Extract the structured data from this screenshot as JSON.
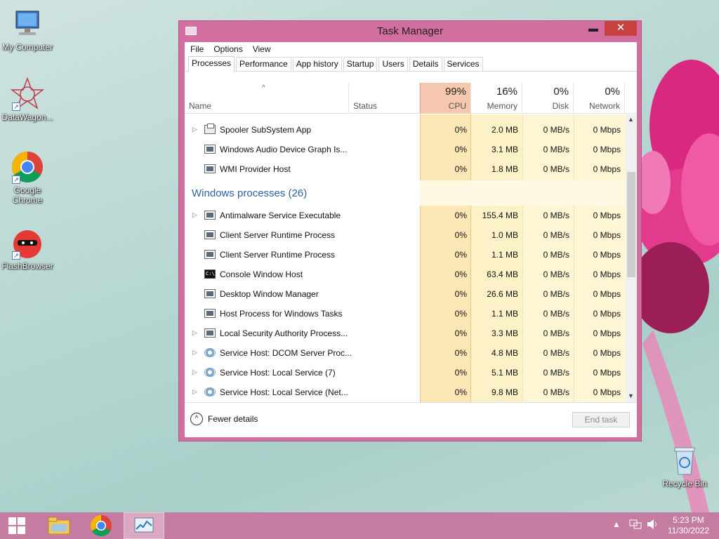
{
  "desktop": {
    "icons": [
      {
        "label": "My Computer"
      },
      {
        "label": "DataWagon..."
      },
      {
        "label": "Google Chrome"
      },
      {
        "label": "FlashBrowser"
      },
      {
        "label": "Recycle Bin"
      }
    ]
  },
  "window": {
    "title": "Task Manager",
    "close_glyph": "✕",
    "min_glyph": "▬",
    "max_glyph": "☐"
  },
  "menu": [
    "File",
    "Options",
    "View"
  ],
  "tabs": [
    "Processes",
    "Performance",
    "App history",
    "Startup",
    "Users",
    "Details",
    "Services"
  ],
  "header": {
    "name": "Name",
    "status": "Status",
    "cpu_pct": "99%",
    "cpu": "CPU",
    "mem_pct": "16%",
    "mem": "Memory",
    "disk_pct": "0%",
    "disk": "Disk",
    "net_pct": "0%",
    "net": "Network"
  },
  "group": "Windows processes (26)",
  "rows": [
    {
      "name": "Spooler SubSystem App",
      "cpu": "0%",
      "mem": "2.0 MB",
      "disk": "0 MB/s",
      "net": "0 Mbps",
      "icon": "printer-icon",
      "expand": true
    },
    {
      "name": "Windows Audio Device Graph Is...",
      "cpu": "0%",
      "mem": "3.1 MB",
      "disk": "0 MB/s",
      "net": "0 Mbps",
      "icon": "window-icon",
      "expand": false
    },
    {
      "name": "WMI Provider Host",
      "cpu": "0%",
      "mem": "1.8 MB",
      "disk": "0 MB/s",
      "net": "0 Mbps",
      "icon": "wmi-icon",
      "expand": false
    },
    {
      "name": "Antimalware Service Executable",
      "cpu": "0%",
      "mem": "155.4 MB",
      "disk": "0 MB/s",
      "net": "0 Mbps",
      "icon": "window-icon",
      "expand": true
    },
    {
      "name": "Client Server Runtime Process",
      "cpu": "0%",
      "mem": "1.0 MB",
      "disk": "0 MB/s",
      "net": "0 Mbps",
      "icon": "window-icon",
      "expand": false
    },
    {
      "name": "Client Server Runtime Process",
      "cpu": "0%",
      "mem": "1.1 MB",
      "disk": "0 MB/s",
      "net": "0 Mbps",
      "icon": "window-icon",
      "expand": false
    },
    {
      "name": "Console Window Host",
      "cpu": "0%",
      "mem": "63.4 MB",
      "disk": "0 MB/s",
      "net": "0 Mbps",
      "icon": "console-icon",
      "expand": false
    },
    {
      "name": "Desktop Window Manager",
      "cpu": "0%",
      "mem": "26.6 MB",
      "disk": "0 MB/s",
      "net": "0 Mbps",
      "icon": "window-icon",
      "expand": false
    },
    {
      "name": "Host Process for Windows Tasks",
      "cpu": "0%",
      "mem": "1.1 MB",
      "disk": "0 MB/s",
      "net": "0 Mbps",
      "icon": "window-icon",
      "expand": false
    },
    {
      "name": "Local Security Authority Process...",
      "cpu": "0%",
      "mem": "3.3 MB",
      "disk": "0 MB/s",
      "net": "0 Mbps",
      "icon": "window-icon",
      "expand": true
    },
    {
      "name": "Service Host: DCOM Server Proc...",
      "cpu": "0%",
      "mem": "4.8 MB",
      "disk": "0 MB/s",
      "net": "0 Mbps",
      "icon": "gear-icon",
      "expand": true
    },
    {
      "name": "Service Host: Local Service (7)",
      "cpu": "0%",
      "mem": "5.1 MB",
      "disk": "0 MB/s",
      "net": "0 Mbps",
      "icon": "gear-icon",
      "expand": true
    },
    {
      "name": "Service Host: Local Service (Net...",
      "cpu": "0%",
      "mem": "9.8 MB",
      "disk": "0 MB/s",
      "net": "0 Mbps",
      "icon": "gear-icon",
      "expand": true
    }
  ],
  "footer": {
    "fewer": "Fewer details",
    "end_task": "End task"
  },
  "taskbar": {
    "time": "5:23 PM",
    "date": "11/30/2022"
  },
  "colors": {
    "window_frame": "#d36fa0",
    "taskbar": "#c47ca0",
    "cpu_header": "#f7c8b0",
    "cpu_column": "#fbe6b6",
    "other_columns": "#fff4cf",
    "group_title": "#2c62a4"
  }
}
